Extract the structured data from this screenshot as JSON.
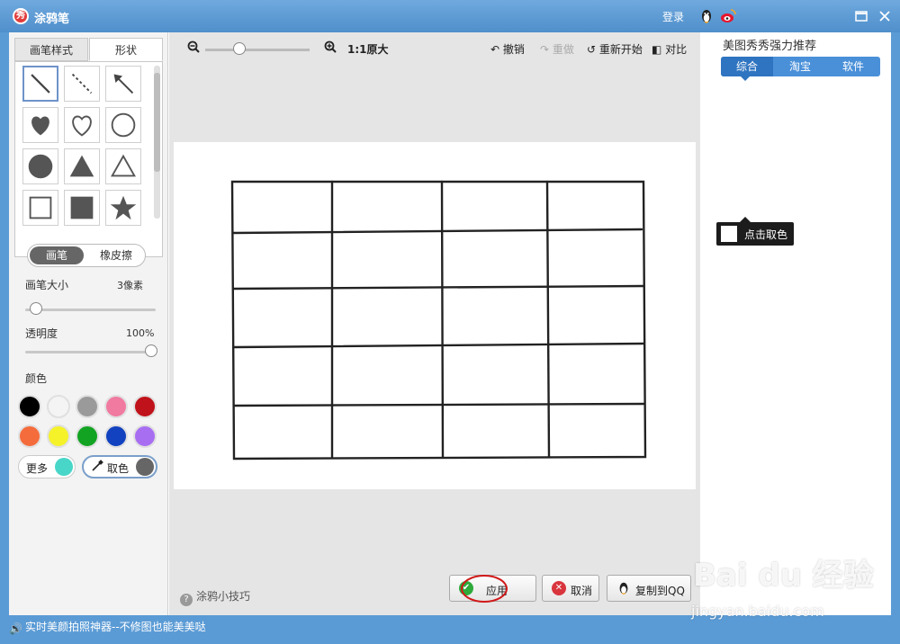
{
  "window": {
    "title": "涂鸦笔",
    "login": "登录",
    "icons": [
      "qq-penguin-icon",
      "weibo-icon",
      "maximize-icon",
      "close-icon"
    ]
  },
  "left": {
    "tabs": [
      {
        "label": "画笔样式"
      },
      {
        "label": "形状"
      }
    ],
    "active_tab": 1,
    "shapes": [
      {
        "name": "line",
        "selected": true
      },
      {
        "name": "dashed-line"
      },
      {
        "name": "arrow"
      },
      {
        "name": "heart-filled"
      },
      {
        "name": "heart-outline"
      },
      {
        "name": "circle-outline"
      },
      {
        "name": "circle-filled"
      },
      {
        "name": "triangle-filled"
      },
      {
        "name": "triangle-outline"
      },
      {
        "name": "square-outline"
      },
      {
        "name": "square-filled"
      },
      {
        "name": "star-filled"
      }
    ],
    "mode": {
      "pen": "画笔",
      "eraser": "橡皮擦"
    },
    "brush_size": {
      "label": "画笔大小",
      "value": "3像素",
      "level": 0.05
    },
    "opacity": {
      "label": "透明度",
      "value": "100%",
      "level": 1.0
    },
    "color_label": "颜色",
    "colors": [
      "#000000",
      "#f4f4f4",
      "#9a9a9a",
      "#f07aa0",
      "#c0121a",
      "#f56c3c",
      "#f5f22a",
      "#12a322",
      "#1242c0",
      "#a86ef2"
    ],
    "more": {
      "label": "更多",
      "color": "#48d6c8"
    },
    "pick": {
      "label": "取色",
      "color": "#666666"
    }
  },
  "toolbar": {
    "zoom_label": "1:1原大",
    "zoom_level": 0.3,
    "undo": "撤销",
    "redo": "重做",
    "restart": "重新开始",
    "compare": "对比"
  },
  "actions": {
    "tips": "涂鸦小技巧",
    "apply": "应用",
    "cancel": "取消",
    "copy": "复制到QQ"
  },
  "right": {
    "title": "美图秀秀强力推荐",
    "tabs": [
      {
        "label": "综合"
      },
      {
        "label": "淘宝"
      },
      {
        "label": "软件"
      }
    ],
    "picker_tip": "点击取色"
  },
  "status": {
    "text": "实时美颜拍照神器--不修图也能美美哒"
  },
  "watermark": {
    "main": "Bai du 经验",
    "sub": "jingyan.baidu.com"
  }
}
